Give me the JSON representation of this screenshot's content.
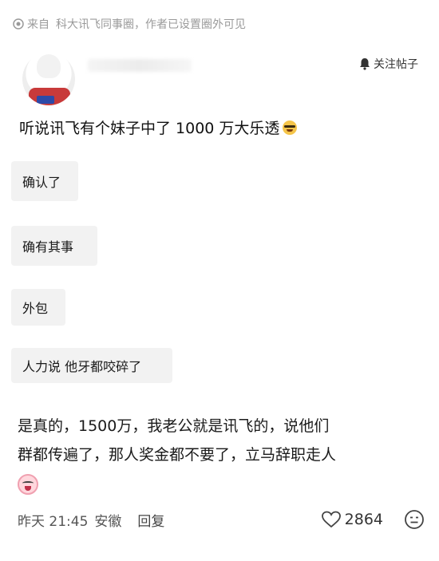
{
  "source": {
    "prefix": "来自",
    "circle_name": "科大讯飞同事圈，",
    "visibility": "作者已设置圈外可见",
    "icon": "target-icon"
  },
  "post": {
    "follow_label": "关注帖子",
    "follow_icon": "bell-icon",
    "title": "听说讯飞有个妹子中了 1000 万大乐透",
    "title_emoji": "nerd-face-icon"
  },
  "comments": [
    {
      "text": "确认了"
    },
    {
      "text": "确有其事"
    },
    {
      "text": "外包"
    },
    {
      "text": "人力说 他牙都咬碎了"
    }
  ],
  "reply": {
    "line1": "是真的，1500万，我老公就是讯飞的，说他们",
    "line2": "群都传遍了，那人奖金都不要了，立马辞职走人",
    "emoji": "crying-face-icon"
  },
  "footer": {
    "time": "昨天 21:45",
    "location": "安徽",
    "reply_label": "回复",
    "like_count": "2864",
    "like_icon": "heart-icon",
    "reaction_icon": "emoji-reaction-icon"
  },
  "colors": {
    "muted_text": "#9a9a9a",
    "bubble_bg": "#f2f2f2"
  }
}
